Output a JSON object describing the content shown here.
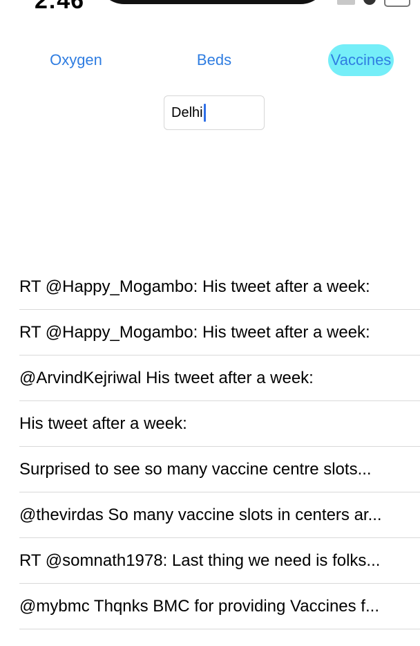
{
  "status_bar": {
    "time": "2:46"
  },
  "tabs": [
    {
      "label": "Oxygen",
      "selected": false
    },
    {
      "label": "Beds",
      "selected": false
    },
    {
      "label": "Vaccines",
      "selected": true
    }
  ],
  "city_field": {
    "value": "Delhi"
  },
  "colors": {
    "accent": "#2f7de1",
    "selected_tab_bg": "#75eef8",
    "separator": "#d9d9d9"
  },
  "tweets": [
    "RT @Happy_Mogambo: His tweet after a week:",
    "RT @Happy_Mogambo: His tweet after a week:",
    "@ArvindKejriwal His tweet after a week:",
    "His tweet after a week:",
    "Surprised to see so many vaccine centre slots...",
    "@thevirdas So many vaccine slots in  centers ar...",
    "RT @somnath1978: Last thing we need is folks...",
    "@mybmc Thqnks BMC for providing Vaccines f..."
  ]
}
